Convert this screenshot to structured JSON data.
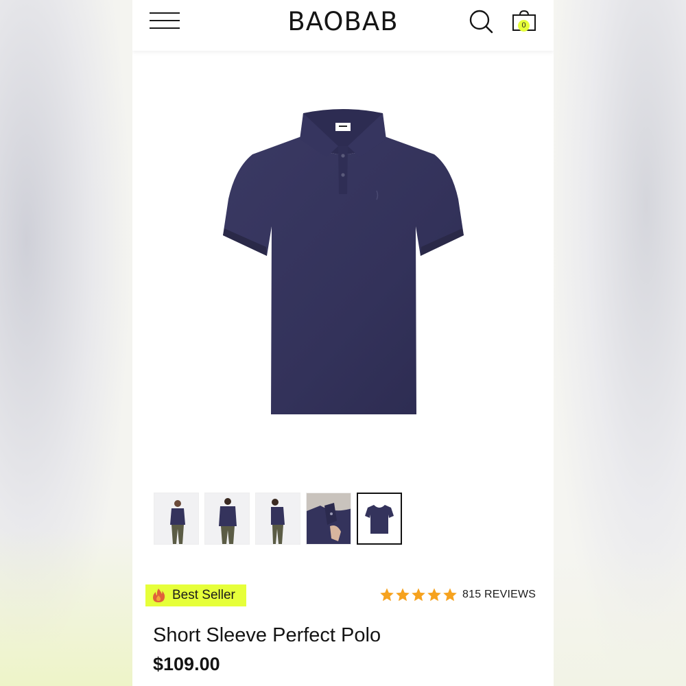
{
  "brand": {
    "logo_text": "BAOBAB"
  },
  "header": {
    "cart_count": "0"
  },
  "icons": {
    "menu": "hamburger-icon",
    "search": "search-icon",
    "cart": "shopping-bag-icon",
    "badge": "fire-icon",
    "rating": "star-icon"
  },
  "gallery": {
    "thumbnails": [
      {
        "name": "front-model-view"
      },
      {
        "name": "back-model-view"
      },
      {
        "name": "side-model-view"
      },
      {
        "name": "collar-detail-view"
      },
      {
        "name": "flat-product-view",
        "selected": true
      }
    ]
  },
  "product": {
    "badge": "Best Seller",
    "rating": {
      "stars": 5,
      "reviews_label": "815 REVIEWS"
    },
    "title": "Short Sleeve Perfect Polo",
    "price": "$109.00"
  },
  "colors": {
    "accent": "#e6ff3a",
    "shirt": "#34335c",
    "star": "#f6a21e",
    "text": "#141414"
  }
}
